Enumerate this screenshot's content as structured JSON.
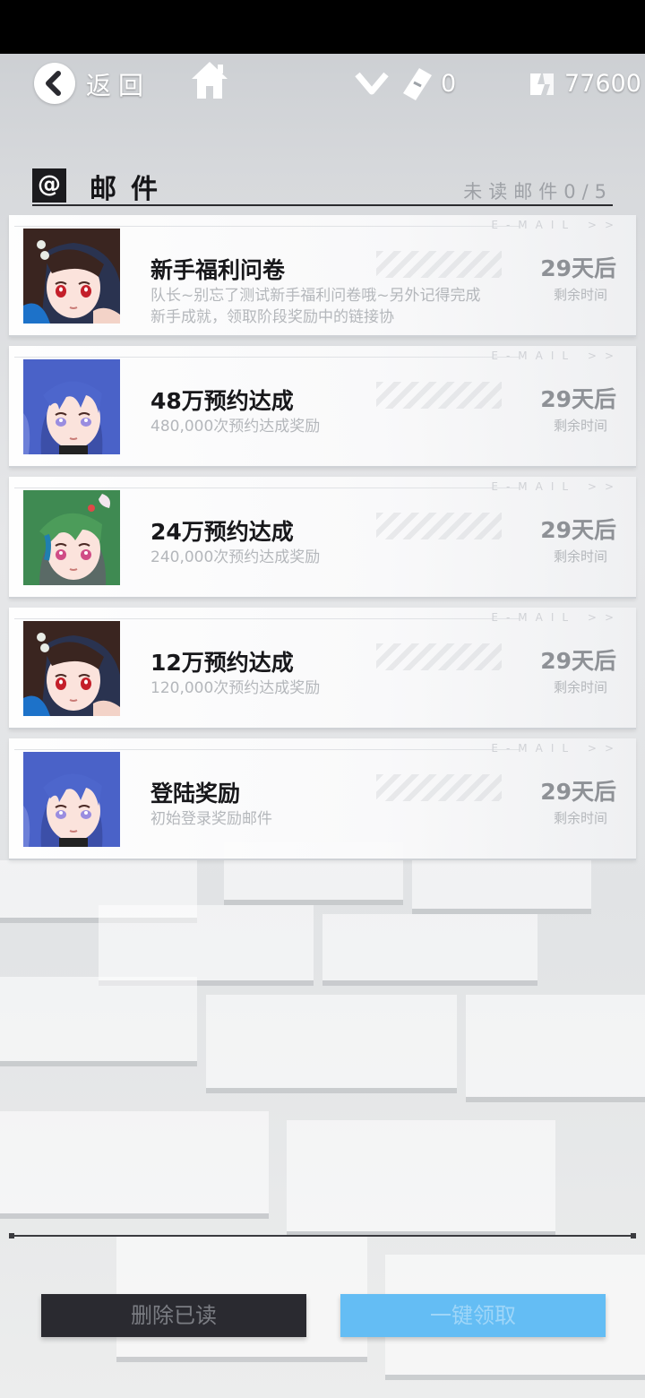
{
  "topbar": {
    "back_label": "返回",
    "ticket_count": "0",
    "coin_count": "77600"
  },
  "header": {
    "title": "邮件",
    "unread": "未读邮件0/5"
  },
  "email_tag": "E-MAIL >>",
  "mails": [
    {
      "title": "新手福利问卷",
      "desc": "队长~别忘了测试新手福利问卷哦~另外记得完成新手成就，领取阶段奖励中的链接协",
      "days": "29天后",
      "remain": "剩余时间",
      "avatar": "brown-hair-girl"
    },
    {
      "title": "48万预约达成",
      "desc": "480,000次预约达成奖励",
      "days": "29天后",
      "remain": "剩余时间",
      "avatar": "blue-hair-girl"
    },
    {
      "title": "24万预约达成",
      "desc": "240,000次预约达成奖励",
      "days": "29天后",
      "remain": "剩余时间",
      "avatar": "green-hair-girl"
    },
    {
      "title": "12万预约达成",
      "desc": "120,000次预约达成奖励",
      "days": "29天后",
      "remain": "剩余时间",
      "avatar": "brown-hair-girl"
    },
    {
      "title": "登陆奖励",
      "desc": "初始登录奖励邮件",
      "days": "29天后",
      "remain": "剩余时间",
      "avatar": "blue-hair-girl"
    }
  ],
  "buttons": {
    "delete_read": "删除已读",
    "claim_all": "一键领取"
  },
  "colors": {
    "claim_button": "#64bdf4",
    "delete_button": "#2a2a30"
  }
}
